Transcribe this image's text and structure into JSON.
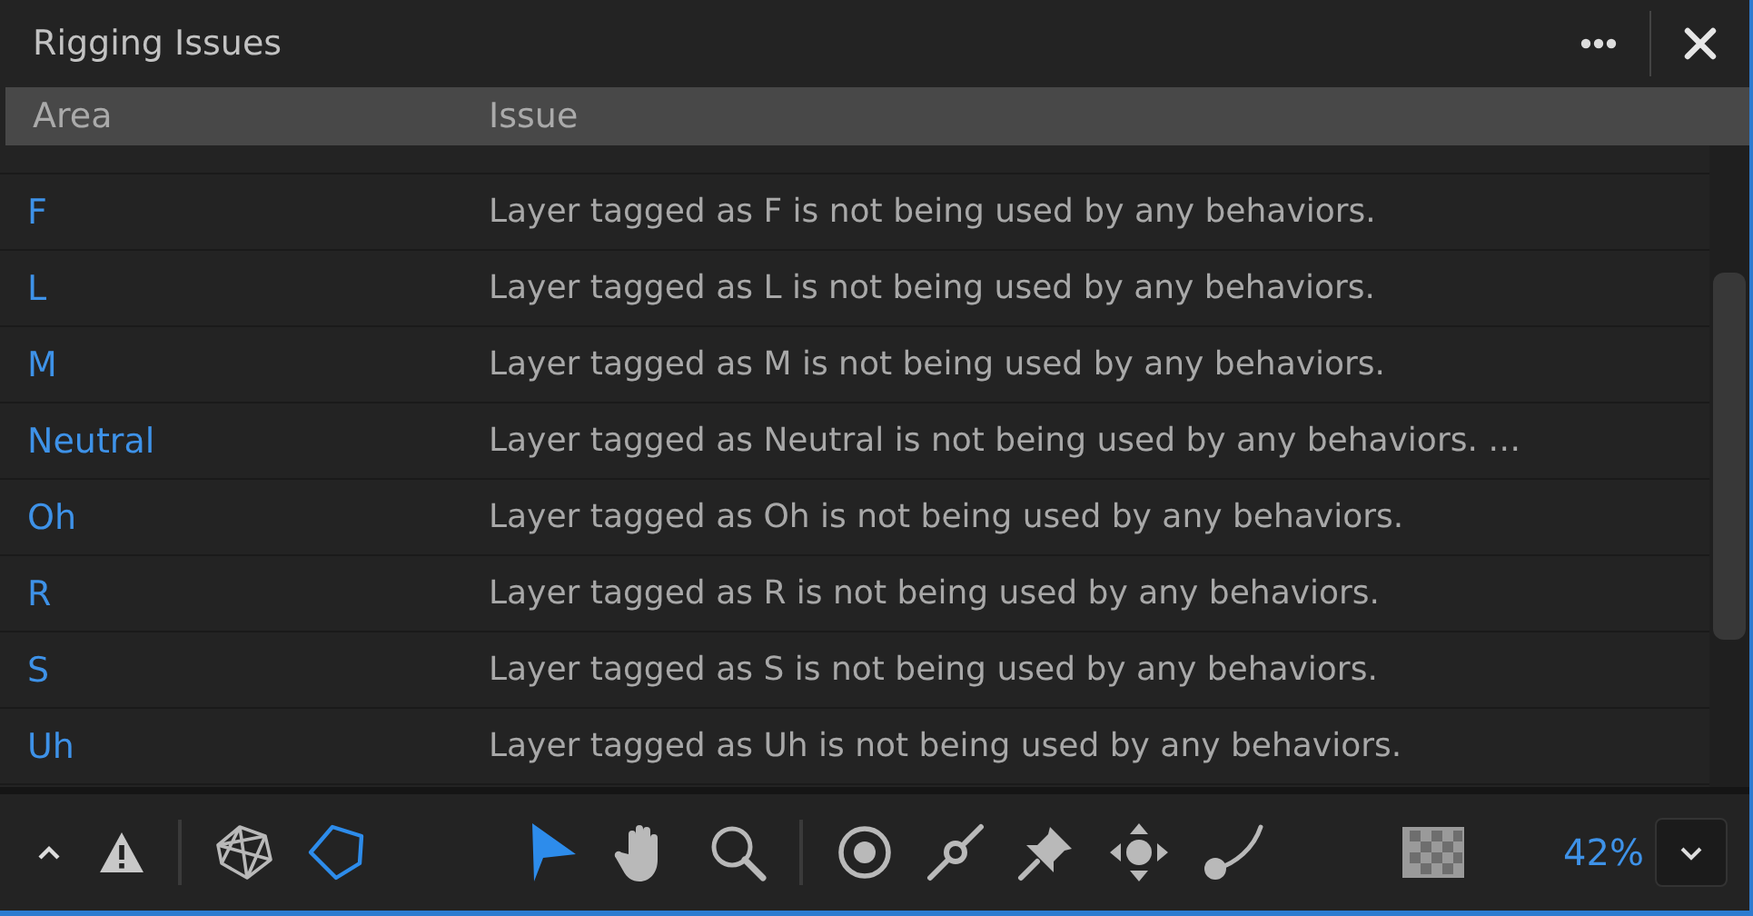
{
  "panel": {
    "title": "Rigging Issues"
  },
  "table": {
    "columns": [
      "Area",
      "Issue"
    ],
    "rows": [
      {
        "area": "F",
        "issue": "Layer tagged as F is not being used by any behaviors."
      },
      {
        "area": "L",
        "issue": "Layer tagged as L is not being used by any behaviors."
      },
      {
        "area": "M",
        "issue": "Layer tagged as M is not being used by any behaviors."
      },
      {
        "area": "Neutral",
        "issue": "Layer tagged as Neutral is not being used by any behaviors. …"
      },
      {
        "area": "Oh",
        "issue": "Layer tagged as Oh is not being used by any behaviors."
      },
      {
        "area": "R",
        "issue": "Layer tagged as R is not being used by any behaviors."
      },
      {
        "area": "S",
        "issue": "Layer tagged as S is not being used by any behaviors."
      },
      {
        "area": "Uh",
        "issue": "Layer tagged as Uh is not being used by any behaviors."
      }
    ]
  },
  "toolbar": {
    "tools": [
      {
        "kind": "mesh",
        "selected": false
      },
      {
        "kind": "pentagon",
        "selected": true
      },
      {
        "kind": "arrow",
        "selected": true
      },
      {
        "kind": "hand",
        "selected": false
      },
      {
        "kind": "zoom",
        "selected": false
      },
      {
        "kind": "target",
        "selected": false
      },
      {
        "kind": "stick",
        "selected": false
      },
      {
        "kind": "pin",
        "selected": false
      },
      {
        "kind": "move",
        "selected": false
      },
      {
        "kind": "curve",
        "selected": false
      }
    ],
    "zoom": "42%"
  }
}
